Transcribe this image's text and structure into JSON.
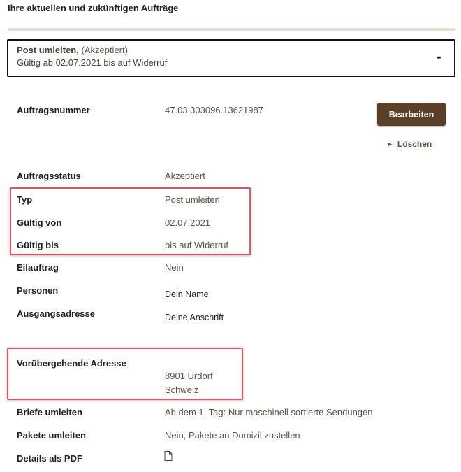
{
  "header": {
    "title": "Ihre aktuellen und zukünftigen Aufträge"
  },
  "order": {
    "title": "Post umleiten,",
    "status": "(Akzeptiert)",
    "validity": "Gültig ab 02.07.2021 bis auf Widerruf",
    "collapse_label": "-"
  },
  "actions": {
    "edit_label": "Bearbeiten",
    "delete_label": "Löschen",
    "delete_icon": "triangle-right-icon"
  },
  "details": {
    "order_number_label": "Auftragsnummer",
    "order_number": "47.03.303096.13621987",
    "status_label": "Auftragsstatus",
    "status": "Akzeptiert",
    "type_label": "Typ",
    "type": "Post umleiten",
    "valid_from_label": "Gültig von",
    "valid_from": "02.07.2021",
    "valid_to_label": "Gültig bis",
    "valid_to": "bis auf Widerruf",
    "express_label": "Eilauftrag",
    "express": "Nein",
    "persons_label": "Personen",
    "persons": "Dein Name",
    "origin_label": "Ausgangsadresse",
    "origin": "Deine Anschrift",
    "temp_address_label": "Vorübergehende Adresse",
    "temp_address_line1": "8901 Urdorf",
    "temp_address_line2": "Schweiz",
    "letters_label": "Briefe umleiten",
    "letters": "Ab dem 1. Tag: Nur maschinell sortierte Sendungen",
    "parcels_label": "Pakete umleiten",
    "parcels": "Nein, Pakete an Domizil zustellen",
    "pdf_label": "Details als PDF",
    "pdf_icon": "document-icon"
  },
  "colors": {
    "accent_brown": "#5a4026",
    "highlight_red": "#e8505b",
    "divider": "#e5e0cf"
  }
}
